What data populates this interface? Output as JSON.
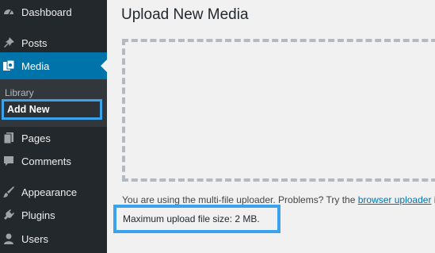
{
  "sidebar": {
    "items": [
      {
        "id": "dashboard",
        "label": "Dashboard",
        "icon": "dashboard-icon"
      },
      {
        "id": "posts",
        "label": "Posts",
        "icon": "pin-icon"
      },
      {
        "id": "media",
        "label": "Media",
        "icon": "media-icon",
        "active": true
      },
      {
        "id": "pages",
        "label": "Pages",
        "icon": "pages-icon"
      },
      {
        "id": "comments",
        "label": "Comments",
        "icon": "comment-icon"
      },
      {
        "id": "appearance",
        "label": "Appearance",
        "icon": "paintbrush-icon"
      },
      {
        "id": "plugins",
        "label": "Plugins",
        "icon": "plugin-icon"
      },
      {
        "id": "users",
        "label": "Users",
        "icon": "user-icon"
      }
    ],
    "media_submenu": {
      "library": "Library",
      "add_new": "Add New"
    }
  },
  "main": {
    "title": "Upload New Media",
    "uploader_note_prefix": "You are using the multi-file uploader. Problems? Try the ",
    "uploader_note_link": "browser uploader",
    "uploader_note_suffix": " in",
    "max_upload": "Maximum upload file size: 2 MB."
  },
  "colors": {
    "sidebar_bg": "#23282d",
    "active_bg": "#0073aa",
    "highlight": "#3ba3ec",
    "link": "#0073aa"
  }
}
